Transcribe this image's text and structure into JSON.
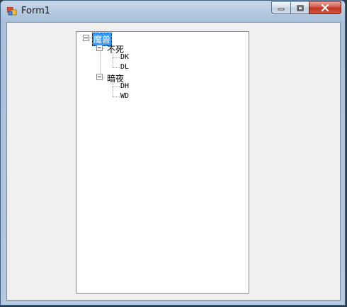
{
  "window": {
    "title": "Form1",
    "icon": "winforms-app-icon",
    "buttons": [
      "minimize-icon",
      "restore-icon",
      "close-icon"
    ]
  },
  "tree": {
    "root": {
      "label": "魔兽",
      "expanded": true,
      "selected": true
    },
    "children": [
      {
        "label": "不死",
        "expanded": true,
        "children": [
          "DK",
          "DL"
        ]
      },
      {
        "label": "暗夜",
        "expanded": true,
        "children": [
          "DH",
          "WD"
        ]
      }
    ]
  },
  "colors": {
    "selection": "#3399ff",
    "client_bg": "#f0f0f0",
    "close_button": "#c0301f"
  }
}
